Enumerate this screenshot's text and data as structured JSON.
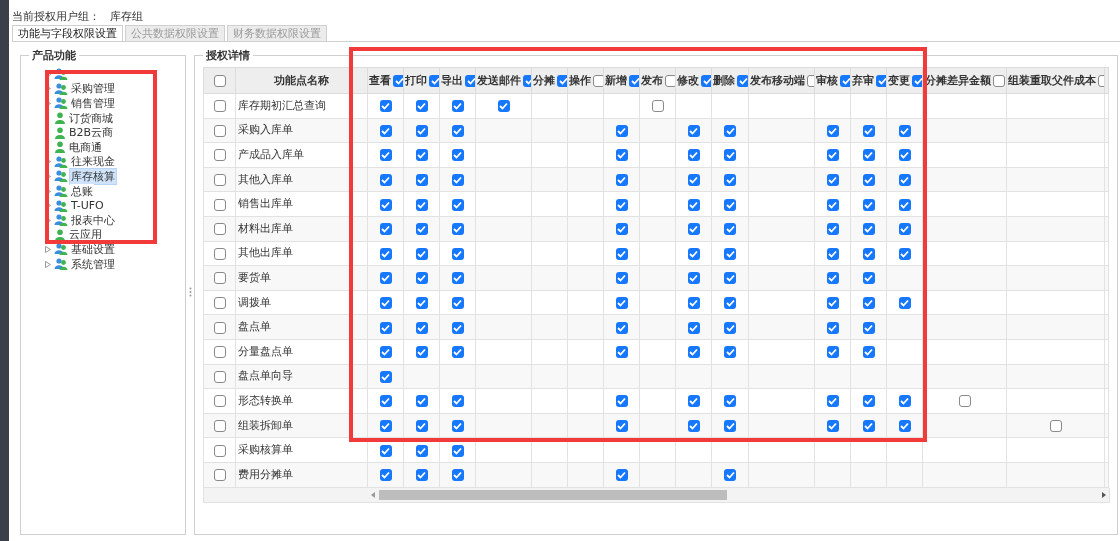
{
  "user_group": {
    "label": "当前授权用户组：",
    "value": "库存组"
  },
  "tabs": [
    {
      "label": "功能与字段权限设置",
      "selected": true
    },
    {
      "label": "公共数据权限设置",
      "selected": false
    },
    {
      "label": "财务数据权限设置",
      "selected": false
    }
  ],
  "product_panel": {
    "title": "产品功能",
    "tree": [
      {
        "kind": "group",
        "expanded": false
      },
      {
        "kind": "group",
        "label": "采购管理",
        "expanded": false,
        "selected": false
      },
      {
        "kind": "group",
        "label": "销售管理",
        "expanded": false,
        "selected": false
      },
      {
        "kind": "leaf",
        "label": "订货商城",
        "selected": false
      },
      {
        "kind": "leaf",
        "label": "B2B云商",
        "selected": false
      },
      {
        "kind": "leaf",
        "label": "电商通",
        "selected": false
      },
      {
        "kind": "group",
        "label": "往来现金",
        "expanded": false,
        "selected": false
      },
      {
        "kind": "group",
        "label": "库存核算",
        "expanded": false,
        "selected": true
      },
      {
        "kind": "group",
        "label": "总账",
        "expanded": false,
        "selected": false
      },
      {
        "kind": "group",
        "label": "T-UFO",
        "expanded": false,
        "selected": false
      },
      {
        "kind": "group",
        "label": "报表中心",
        "expanded": false,
        "selected": false
      },
      {
        "kind": "leaf",
        "label": "云应用",
        "selected": false
      },
      {
        "kind": "group",
        "label": "基础设置",
        "expanded": false,
        "selected": false
      },
      {
        "kind": "group",
        "label": "系统管理",
        "expanded": false,
        "selected": false
      }
    ]
  },
  "detail_panel": {
    "title": "授权详情",
    "table": {
      "select_all": {
        "checked": false
      },
      "name_column": "功能点名称",
      "columns": [
        {
          "label": "查看",
          "checked": true
        },
        {
          "label": "打印",
          "checked": true
        },
        {
          "label": "导出",
          "checked": true
        },
        {
          "label": "发送邮件",
          "checked": true
        },
        {
          "label": "分摊",
          "checked": true
        },
        {
          "label": "操作",
          "checked": false
        },
        {
          "label": "新增",
          "checked": true
        },
        {
          "label": "发布",
          "checked": false
        },
        {
          "label": "修改",
          "checked": true
        },
        {
          "label": "删除",
          "checked": true
        },
        {
          "label": "发布移动端",
          "checked": false
        },
        {
          "label": "审核",
          "checked": true
        },
        {
          "label": "弃审",
          "checked": true
        },
        {
          "label": "变更",
          "checked": true
        },
        {
          "label": "分摊差异金额",
          "checked": false
        },
        {
          "label": "组装重取父件成本",
          "checked": false
        }
      ],
      "rows": [
        {
          "name": "库存期初汇总查询",
          "checked": false,
          "cells": [
            true,
            true,
            true,
            true,
            null,
            null,
            null,
            false,
            null,
            null,
            null,
            null,
            null,
            null,
            null,
            null
          ]
        },
        {
          "name": "采购入库单",
          "checked": false,
          "cells": [
            true,
            true,
            true,
            null,
            null,
            null,
            true,
            null,
            true,
            true,
            null,
            true,
            true,
            true,
            null,
            null
          ]
        },
        {
          "name": "产成品入库单",
          "checked": false,
          "cells": [
            true,
            true,
            true,
            null,
            null,
            null,
            true,
            null,
            true,
            true,
            null,
            true,
            true,
            true,
            null,
            null
          ]
        },
        {
          "name": "其他入库单",
          "checked": false,
          "cells": [
            true,
            true,
            true,
            null,
            null,
            null,
            true,
            null,
            true,
            true,
            null,
            true,
            true,
            true,
            null,
            null
          ]
        },
        {
          "name": "销售出库单",
          "checked": false,
          "cells": [
            true,
            true,
            true,
            null,
            null,
            null,
            true,
            null,
            true,
            true,
            null,
            true,
            true,
            true,
            null,
            null
          ]
        },
        {
          "name": "材料出库单",
          "checked": false,
          "cells": [
            true,
            true,
            true,
            null,
            null,
            null,
            true,
            null,
            true,
            true,
            null,
            true,
            true,
            true,
            null,
            null
          ]
        },
        {
          "name": "其他出库单",
          "checked": false,
          "cells": [
            true,
            true,
            true,
            null,
            null,
            null,
            true,
            null,
            true,
            true,
            null,
            true,
            true,
            true,
            null,
            null
          ]
        },
        {
          "name": "要货单",
          "checked": false,
          "cells": [
            true,
            true,
            true,
            null,
            null,
            null,
            true,
            null,
            true,
            true,
            null,
            true,
            true,
            null,
            null,
            null
          ]
        },
        {
          "name": "调拨单",
          "checked": false,
          "cells": [
            true,
            true,
            true,
            null,
            null,
            null,
            true,
            null,
            true,
            true,
            null,
            true,
            true,
            true,
            null,
            null
          ]
        },
        {
          "name": "盘点单",
          "checked": false,
          "cells": [
            true,
            true,
            true,
            null,
            null,
            null,
            true,
            null,
            true,
            true,
            null,
            true,
            true,
            null,
            null,
            null
          ]
        },
        {
          "name": "分量盘点单",
          "checked": false,
          "cells": [
            true,
            true,
            true,
            null,
            null,
            null,
            true,
            null,
            true,
            true,
            null,
            true,
            true,
            null,
            null,
            null
          ]
        },
        {
          "name": "盘点单向导",
          "checked": false,
          "cells": [
            true,
            null,
            null,
            null,
            null,
            null,
            null,
            null,
            null,
            null,
            null,
            null,
            null,
            null,
            null,
            null
          ]
        },
        {
          "name": "形态转换单",
          "checked": false,
          "cells": [
            true,
            true,
            true,
            null,
            null,
            null,
            true,
            null,
            true,
            true,
            null,
            true,
            true,
            true,
            false,
            null
          ]
        },
        {
          "name": "组装拆卸单",
          "checked": false,
          "cells": [
            true,
            true,
            true,
            null,
            null,
            null,
            true,
            null,
            true,
            true,
            null,
            true,
            true,
            true,
            null,
            false
          ]
        },
        {
          "name": "采购核算单",
          "checked": false,
          "cells": [
            true,
            true,
            true,
            null,
            null,
            null,
            null,
            null,
            null,
            null,
            null,
            null,
            null,
            null,
            null,
            null
          ]
        },
        {
          "name": "费用分摊单",
          "checked": false,
          "cells": [
            true,
            true,
            true,
            null,
            null,
            null,
            true,
            null,
            null,
            true,
            null,
            null,
            null,
            null,
            null,
            null
          ]
        }
      ]
    }
  }
}
